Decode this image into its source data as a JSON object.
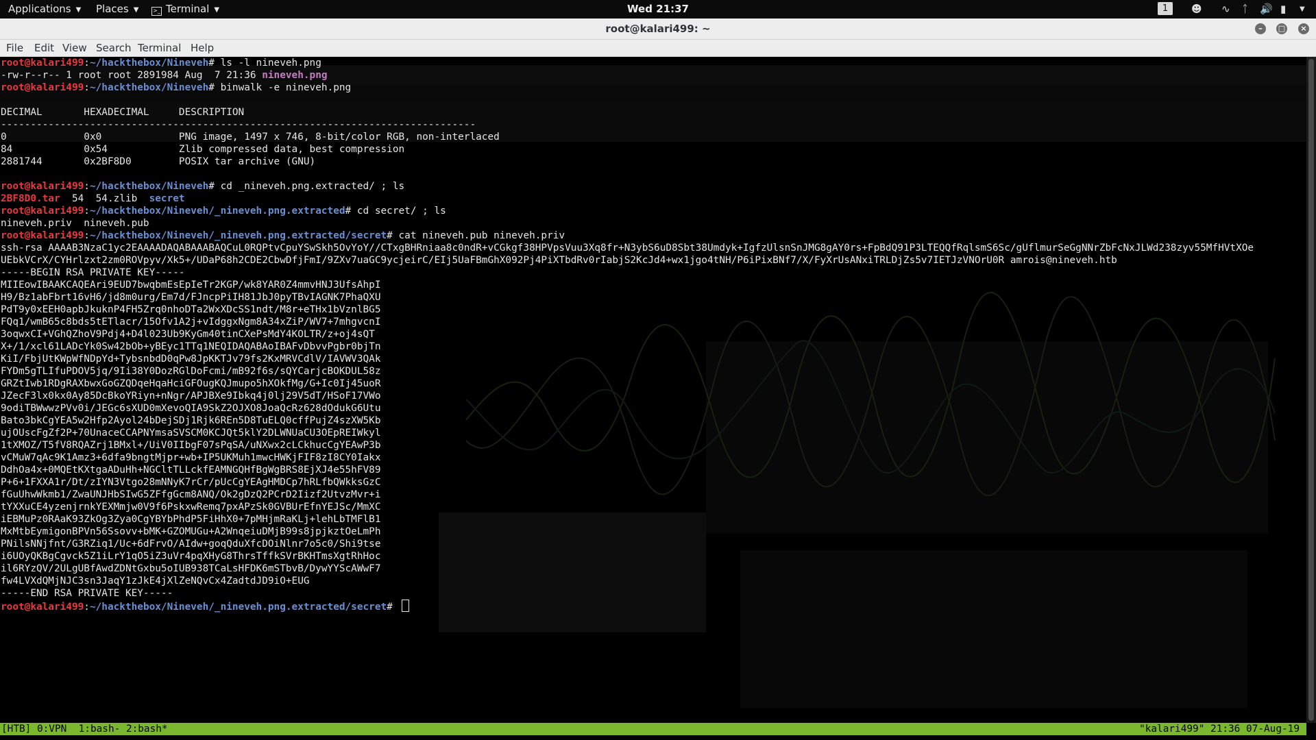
{
  "topbar": {
    "applications": "Applications",
    "places": "Places",
    "terminal": "Terminal",
    "clock": "Wed 21:37",
    "workspace": "1"
  },
  "window": {
    "title": "root@kalari499: ~"
  },
  "menubar": {
    "items": [
      "File",
      "Edit",
      "View",
      "Search",
      "Terminal",
      "Help"
    ]
  },
  "terminal": {
    "prompt_user": "root@kalari499",
    "lines": [
      {
        "type": "prompt",
        "path": "~/hackthebox/Nineveh",
        "cmd": "ls -l nineveh.png"
      },
      {
        "type": "lsline",
        "meta": "-rw-r--r-- 1 root root 2891984 Aug  7 21:36 ",
        "file": "nineveh.png"
      },
      {
        "type": "prompt",
        "path": "~/hackthebox/Nineveh",
        "cmd": "binwalk -e nineveh.png"
      },
      {
        "type": "text",
        "text": ""
      },
      {
        "type": "text",
        "text": "DECIMAL       HEXADECIMAL     DESCRIPTION"
      },
      {
        "type": "text",
        "text": "--------------------------------------------------------------------------------"
      },
      {
        "type": "text",
        "text": "0             0x0             PNG image, 1497 x 746, 8-bit/color RGB, non-interlaced"
      },
      {
        "type": "text",
        "text": "84            0x54            Zlib compressed data, best compression"
      },
      {
        "type": "text",
        "text": "2881744       0x2BF8D0        POSIX tar archive (GNU)"
      },
      {
        "type": "text",
        "text": ""
      },
      {
        "type": "prompt",
        "path": "~/hackthebox/Nineveh",
        "cmd": "cd _nineveh.png.extracted/ ; ls"
      },
      {
        "type": "lslist",
        "archive": "2BF8D0.tar",
        "plain": "  54  54.zlib  ",
        "dir": "secret"
      },
      {
        "type": "prompt",
        "path": "~/hackthebox/Nineveh/_nineveh.png.extracted",
        "cmd": "cd secret/ ; ls"
      },
      {
        "type": "text",
        "text": "nineveh.priv  nineveh.pub"
      },
      {
        "type": "prompt",
        "path": "~/hackthebox/Nineveh/_nineveh.png.extracted/secret",
        "cmd": "cat nineveh.pub nineveh.priv"
      },
      {
        "type": "text",
        "text": "ssh-rsa AAAAB3NzaC1yc2EAAAADAQABAAABAQCuL0RQPtvCpuYSwSkh5OvYoY//CTxgBHRniaa8c0ndR+vCGkgf38HPVpsVuu3Xq8fr+N3ybS6uD8Sbt38Umdyk+IgfzUlsnSnJMG8gAY0rs+FpBdQ91P3LTEQQfRqlsmS6Sc/gUflmurSeGgNNrZbFcNxJLWd238zyv55MfHVtXOe"
      },
      {
        "type": "text",
        "text": "UEbkVCrX/CYHrlzxt2zm0ROVpyv/Xk5+/UDaP68h2CDE2CbwDfjFmI/9ZXv7uaGC9ycjeirC/EIj5UaFBmGhX092Pj4PiXTbdRv0rIabjS2KcJd4+wx1jgo4tNH/P6iPixBNf7/X/FyXrUsANxiTRLDjZs5v7IETJzVNOrU0R amrois@nineveh.htb"
      },
      {
        "type": "text",
        "text": "-----BEGIN RSA PRIVATE KEY-----"
      },
      {
        "type": "text",
        "text": "MIIEowIBAAKCAQEAri9EUD7bwqbmEsEpIeTr2KGP/wk8YAR0Z4mmvHNJ3UfsAhpI"
      },
      {
        "type": "text",
        "text": "H9/Bz1abFbrt16vH6/jd8m0urg/Em7d/FJncpPiIH81JbJ0pyTBvIAGNK7PhaQXU"
      },
      {
        "type": "text",
        "text": "PdT9y0xEEH0apbJkuknP4FH5Zrq0nhoDTa2WxXDcSS1ndt/M8r+eTHx1bVznlBG5"
      },
      {
        "type": "text",
        "text": "FQq1/wmB65c8bds5tETlacr/15Ofv1A2j+vIdggxNgm8A34xZiP/WV7+7mhgvcnI"
      },
      {
        "type": "text",
        "text": "3oqwxCI+VGhQZhoV9Pdj4+D4l023Ub9KyGm40tinCXePsMdY4KOLTR/z+oj4sQT"
      },
      {
        "type": "text",
        "text": "X+/1/xcl61LADcYk0Sw42bOb+yBEyc1TTq1NEQIDAQABAoIBAFvDbvvPgbr0bjTn"
      },
      {
        "type": "text",
        "text": "KiI/FbjUtKWpWfNDpYd+TybsnbdD0qPw8JpKKTJv79fs2KxMRVCdlV/IAVWV3QAk"
      },
      {
        "type": "text",
        "text": "FYDm5gTLIfuPDOV5jq/9Ii38Y0DozRGlDoFcmi/mB92f6s/sQYCarjcBOKDUL58z"
      },
      {
        "type": "text",
        "text": "GRZtIwb1RDgRAXbwxGoGZQDqeHqaHciGFOugKQJmupo5hXOkfMg/G+Ic0Ij45uoR"
      },
      {
        "type": "text",
        "text": "JZecF3lx0kx0Ay85DcBkoYRiyn+nNgr/APJBXe9Ibkq4j0lj29V5dT/HSoF17VWo"
      },
      {
        "type": "text",
        "text": "9odiTBWwwzPVv0i/JEGc6sXUD0mXevoQIA9SkZ2OJXO8JoaQcRz628dOdukG6Utu"
      },
      {
        "type": "text",
        "text": "Bato3bkCgYEA5w2Hfp2Ayol24bDejSDj1Rjk6REn5D8TuELQ0cffPujZ4szXW5Kb"
      },
      {
        "type": "text",
        "text": "ujOUscFgZf2P+70UnaceCCAPNYmsaSVSCM0KCJQt5klY2DLWNUaCU3OEpREIWkyl"
      },
      {
        "type": "text",
        "text": "1tXMOZ/T5fV8RQAZrj1BMxl+/UiV0IIbgF07sPqSA/uNXwx2cLCkhucCgYEAwP3b"
      },
      {
        "type": "text",
        "text": "vCMuW7qAc9K1Amz3+6dfa9bngtMjpr+wb+IP5UKMuh1mwcHWKjFIF8zI8CY0Iakx"
      },
      {
        "type": "text",
        "text": "DdhOa4x+0MQEtKXtgaADuHh+NGCltTLLckfEAMNGQHfBgWgBRS8EjXJ4e55hFV89"
      },
      {
        "type": "text",
        "text": "P+6+1FXXA1r/Dt/zIYN3Vtgo28mNNyK7rCr/pUcCgYEAgHMDCp7hRLfbQWkksGzC"
      },
      {
        "type": "text",
        "text": "fGuUhwWkmb1/ZwaUNJHbSIwG5ZFfgGcm8ANQ/Ok2gDzQ2PCrD2Iizf2UtvzMvr+i"
      },
      {
        "type": "text",
        "text": "tYXXuCE4yzenjrnkYEXMmjw0V9f6PskxwRemq7pxAPzSk0GVBUrEfnYEJSc/MmXC"
      },
      {
        "type": "text",
        "text": "iEBMuPz0RAaK93ZkOg3Zya0CgYBYbPhdP5FiHhX0+7pMHjmRaKLj+lehLbTMFlB1"
      },
      {
        "type": "text",
        "text": "MxMtbEymigonBPVn56Ssovv+bMK+GZOMUGu+A2WnqeiuDMjB99s8jpjkztOeLmPh"
      },
      {
        "type": "text",
        "text": "PNilsNNjfnt/G3RZiq1/Uc+6dFrvO/AIdw+goqQduXfcDOiNlnr7o5c0/Shi9tse"
      },
      {
        "type": "text",
        "text": "i6UOyQKBgCgvck5Z1iLrY1qO5iZ3uVr4pqXHyG8ThrsTffkSVrBKHTmsXgtRhHoc"
      },
      {
        "type": "text",
        "text": "il6RYzQV/2ULgUBfAwdZDNtGxbu5oIUB938TCaLsHFDK6mSTbvB/DywYYScAWwF7"
      },
      {
        "type": "text",
        "text": "fw4LVXdQMjNJC3sn3JaqY1zJkE4jXlZeNQvCx4ZadtdJD9iO+EUG"
      },
      {
        "type": "text",
        "text": "-----END RSA PRIVATE KEY-----"
      },
      {
        "type": "prompt_cursor",
        "path": "~/hackthebox/Nineveh/_nineveh.png.extracted/secret",
        "cmd": ""
      }
    ]
  },
  "tmux": {
    "left": "[HTB] 0:VPN  1:bash- 2:bash*",
    "right": "\"kalari499\" 21:36 07-Aug-19"
  },
  "colors": {
    "prompt_user": "#e8393e",
    "prompt_path": "#6a8fd2",
    "tmux_bar": "#7bb830",
    "image_file": "#c57cc4"
  }
}
